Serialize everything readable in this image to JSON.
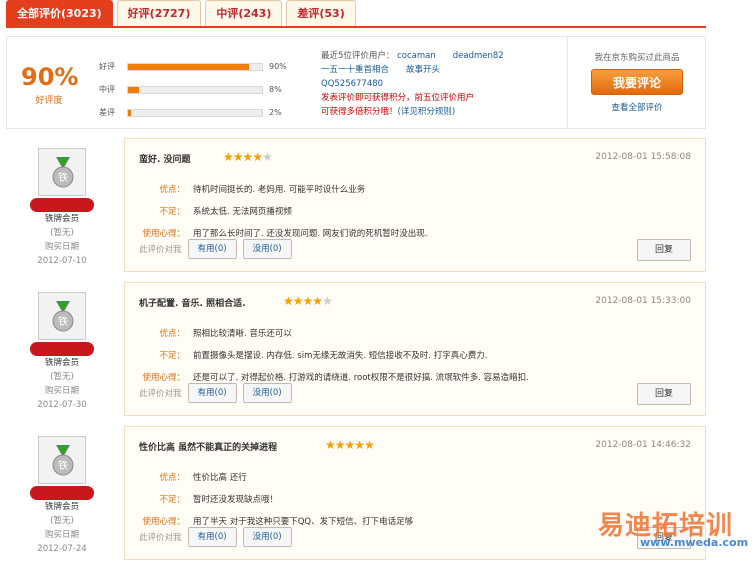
{
  "tabs": [
    {
      "label": "全部评价(3023)"
    },
    {
      "label": "好评(2727)"
    },
    {
      "label": "中评(243)"
    },
    {
      "label": "差评(53)"
    }
  ],
  "summary": {
    "rating_pct": "90%",
    "rating_label": "好评度",
    "bars": [
      {
        "label": "好评",
        "pct": "90%",
        "value": 0.9
      },
      {
        "label": "中评",
        "pct": "8%",
        "value": 0.08
      },
      {
        "label": "差评",
        "pct": "2%",
        "value": 0.02
      }
    ],
    "recent": {
      "head": "最近5位评价用户：",
      "users": "cocaman　　deadmen82",
      "line2": "一五一十重首相合　　故事开头",
      "line3": "QQ525677480",
      "notice1": "发表评价即可获得积分，前五位评价用户",
      "notice2": "可获得多倍积分哦！",
      "rule": "(详见积分规则)"
    },
    "cta_q": "我在京东购买过此商品",
    "cta_btn": "我要评论",
    "cta_link": "查看全部评价"
  },
  "reviews": [
    {
      "level": "铁牌会员",
      "medal": "铁",
      "region": "(暂无)",
      "buy_label": "购买日期",
      "buy_date": "2012-07-10",
      "title": "蛮好. 没问题",
      "stars": 4,
      "date": "2012-08-01 15:58:08",
      "pros_k": "优点：",
      "pros": "待机时间挺长的. 老妈用. 可能平时设什么业务",
      "cons_k": "不足：",
      "cons": "系统太低. 无法网页播视频",
      "exp_k": "使用心得：",
      "exp": "用了那么长时间了. 还没发现问题. 网友们说的死机暂时没出现.",
      "useful_q": "此评价对我",
      "useful": "有用(0)",
      "useless": "没用(0)",
      "reply": "回复"
    },
    {
      "level": "铁牌会员",
      "medal": "铁",
      "region": "(暂无)",
      "buy_label": "购买日期",
      "buy_date": "2012-07-30",
      "title": "机子配置. 音乐. 照相合适.",
      "stars": 4,
      "date": "2012-08-01 15:33:00",
      "pros_k": "优点：",
      "pros": "照相比较清晰. 音乐还可以",
      "cons_k": "不足：",
      "cons": "前置摄像头是摆设. 内存低. sim无缘无故消失. 短信接收不及时. 打字真心费力.",
      "exp_k": "使用心得：",
      "exp": "还是可以了. 对得起价格. 打游戏的请绕道. root权限不是很好搞. 流氓软件多. 容易造暗扣.",
      "useful_q": "此评价对我",
      "useful": "有用(0)",
      "useless": "没用(0)",
      "reply": "回复"
    },
    {
      "level": "铁牌会员",
      "medal": "铁",
      "region": "(暂无)",
      "buy_label": "购买日期",
      "buy_date": "2012-07-24",
      "title": "性价比高 虽然不能真正的关掉进程",
      "stars": 5,
      "date": "2012-08-01 14:46:32",
      "pros_k": "优点：",
      "pros": "性价比高 还行",
      "cons_k": "不足：",
      "cons": "暂时还没发现缺点哦！",
      "exp_k": "使用心得：",
      "exp": "用了半天 对于我这种只要下QQ、发下短信、打下电话足够",
      "useful_q": "此评价对我",
      "useful": "有用(0)",
      "useless": "没用(0)",
      "reply": "回复"
    }
  ],
  "watermark": "易迪拓培训",
  "watermark_url": "www.mweda.com"
}
